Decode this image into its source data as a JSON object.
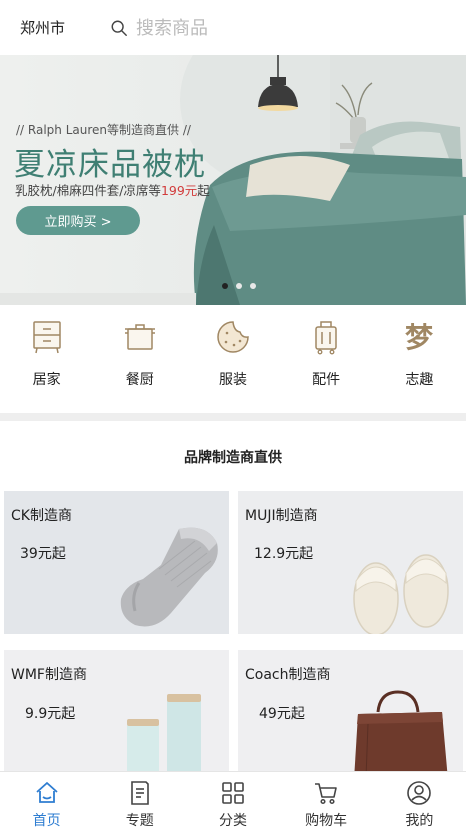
{
  "header": {
    "city": "郑州市",
    "search_placeholder": "搜索商品"
  },
  "banner": {
    "subtitle": "// Ralph Lauren等制造商直供 //",
    "title": "夏凉床品被枕",
    "desc_prefix": "乳胶枕/棉麻四件套/凉席等",
    "desc_price": "199元",
    "desc_suffix": "起",
    "button": "立即购买 >",
    "accent_color": "#3f7f73",
    "price_color": "#d23b3b"
  },
  "categories": [
    {
      "label": "居家",
      "icon": "cabinet-icon"
    },
    {
      "label": "餐厨",
      "icon": "pot-icon"
    },
    {
      "label": "服装",
      "icon": "cookie-icon"
    },
    {
      "label": "配件",
      "icon": "luggage-icon"
    },
    {
      "label": "志趣",
      "icon": "dream-icon"
    }
  ],
  "section_title": "品牌制造商直供",
  "products": [
    {
      "name": "CK制造商",
      "price": "39元起",
      "image": "sock-image"
    },
    {
      "name": "MUJI制造商",
      "price": "12.9元起",
      "image": "slippers-image"
    },
    {
      "name": "WMF制造商",
      "price": "9.9元起",
      "image": "jars-image"
    },
    {
      "name": "Coach制造商",
      "price": "49元起",
      "image": "bag-image"
    }
  ],
  "tabs": [
    {
      "label": "首页",
      "icon": "home-icon",
      "active": true
    },
    {
      "label": "专题",
      "icon": "document-icon",
      "active": false
    },
    {
      "label": "分类",
      "icon": "grid-icon",
      "active": false
    },
    {
      "label": "购物车",
      "icon": "cart-icon",
      "active": false
    },
    {
      "label": "我的",
      "icon": "user-icon",
      "active": false
    }
  ],
  "colors": {
    "active_tab": "#2e7dd1",
    "icon_gold": "#a08763"
  }
}
